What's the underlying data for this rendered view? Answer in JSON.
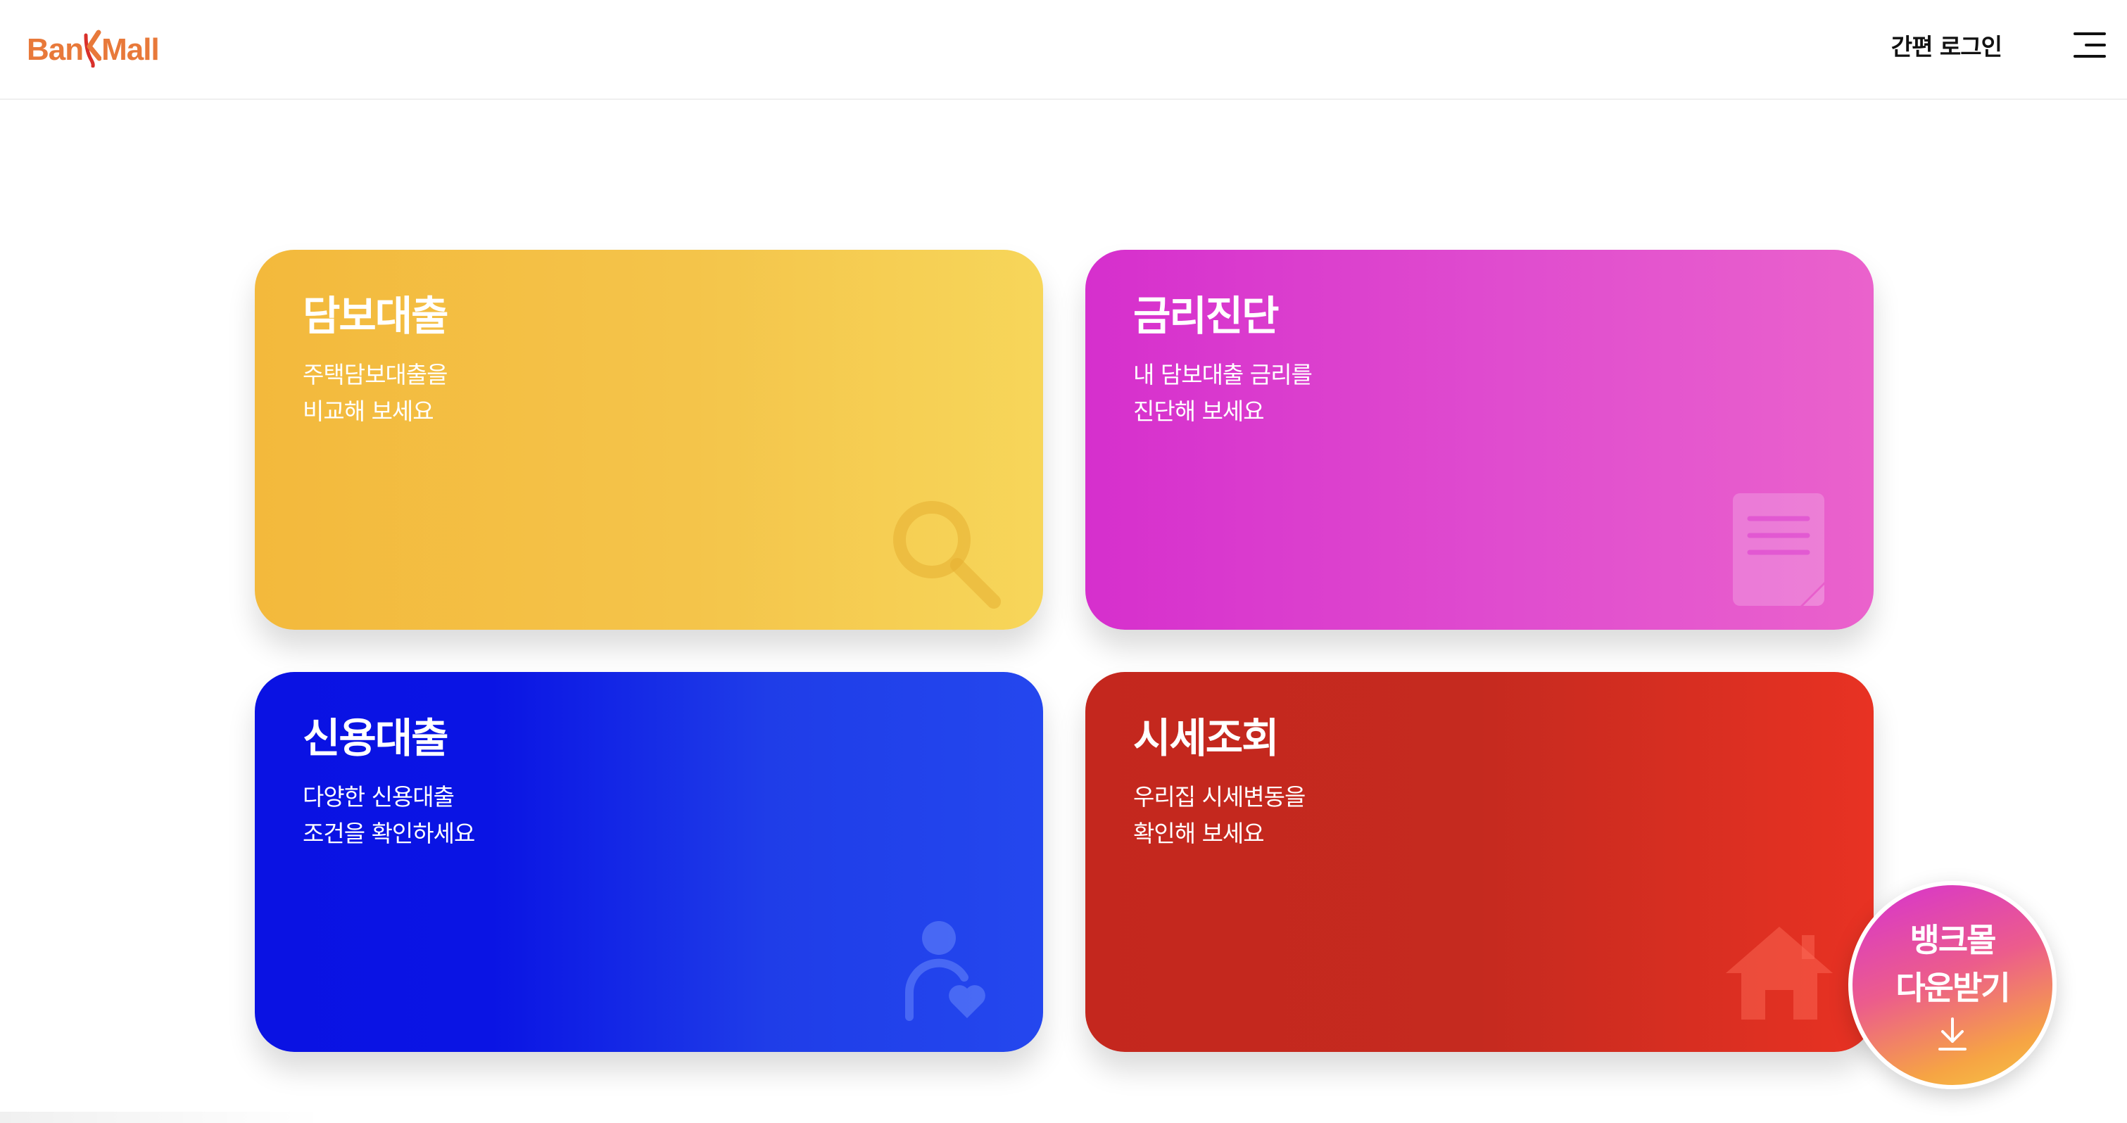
{
  "header": {
    "logo": {
      "text_before": "Ban",
      "text_after": "Mall",
      "color": "#e8793a",
      "accent_color": "#d9302a"
    },
    "login_label": "간편 로그인",
    "menu_icon": "hamburger-menu-icon"
  },
  "cards": [
    {
      "title": "담보대출",
      "desc_line1": "주택담보대출을",
      "desc_line2": "비교해 보세요",
      "icon": "magnifier-icon",
      "colors": [
        "#f3b93c",
        "#f7d65a"
      ]
    },
    {
      "title": "금리진단",
      "desc_line1": "내 담보대출 금리를",
      "desc_line2": "진단해 보세요",
      "icon": "document-icon",
      "colors": [
        "#d62fcd",
        "#ea62cc"
      ]
    },
    {
      "title": "신용대출",
      "desc_line1": "다양한 신용대출",
      "desc_line2": "조건을 확인하세요",
      "icon": "person-heart-icon",
      "colors": [
        "#0a12e3",
        "#2447ee"
      ]
    },
    {
      "title": "시세조회",
      "desc_line1": "우리집 시세변동을",
      "desc_line2": "확인해 보세요",
      "icon": "house-icon",
      "colors": [
        "#c4271e",
        "#e83223"
      ]
    }
  ],
  "download": {
    "line1": "뱅크몰",
    "line2": "다운받기",
    "icon": "download-arrow-icon"
  }
}
